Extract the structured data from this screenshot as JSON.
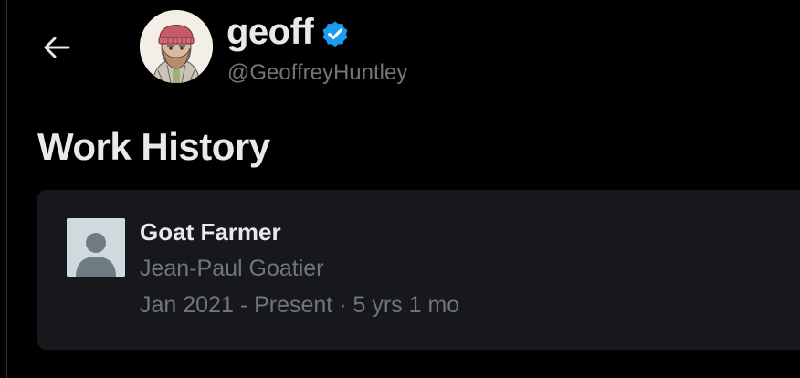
{
  "header": {
    "back_icon": "arrow-left-icon",
    "profile": {
      "name": "geoff",
      "verified_icon": "verified-badge-icon",
      "verified_color": "#1d9bf0",
      "handle": "@GeoffreyHuntley"
    }
  },
  "section": {
    "title": "Work History"
  },
  "work_history": [
    {
      "logo_icon": "company-placeholder-icon",
      "title": "Goat Farmer",
      "company": "Jean-Paul Goatier",
      "period": "Jan 2021 - Present",
      "separator": " · ",
      "duration": "5 yrs 1 mo"
    }
  ],
  "colors": {
    "background": "#000000",
    "card": "#16181c",
    "primary_text": "#e7e9ea",
    "secondary_text": "#71767b"
  }
}
